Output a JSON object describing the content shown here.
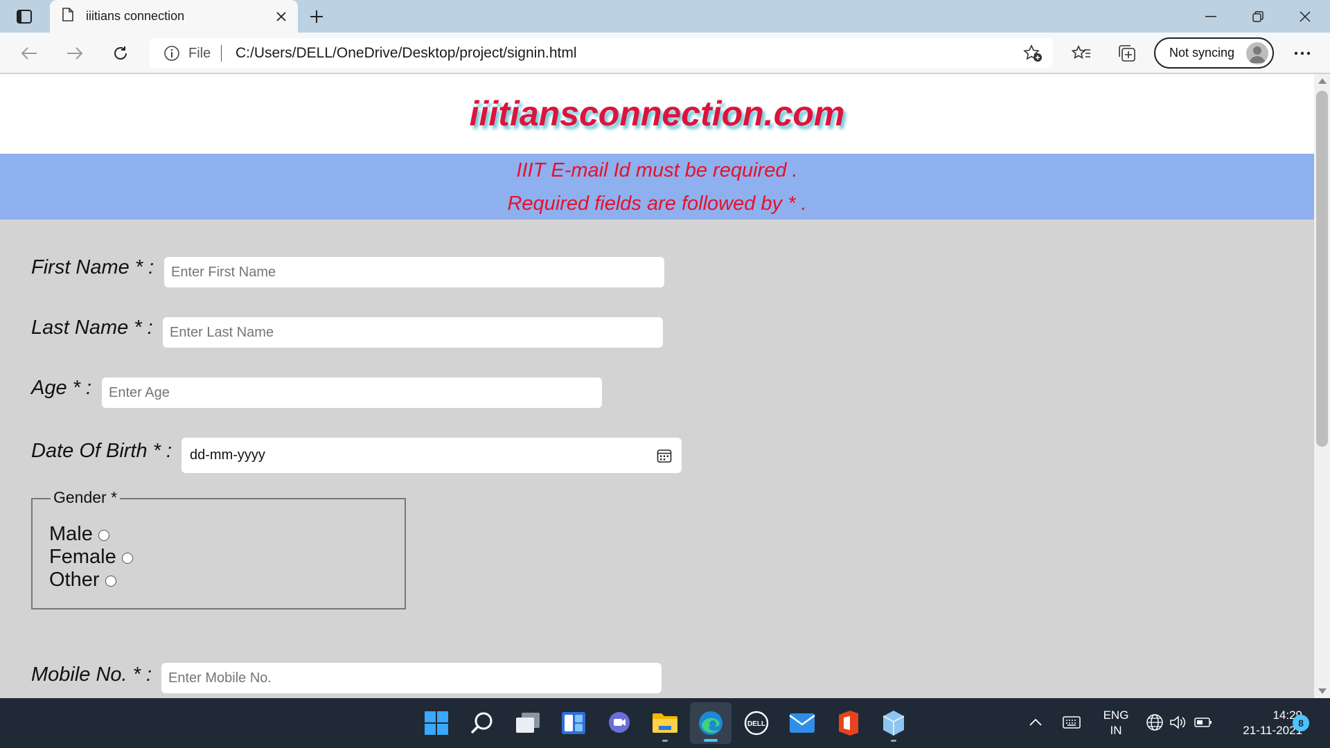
{
  "browser": {
    "tab_title": "iiitians connection",
    "address_file_label": "File",
    "address_url": "C:/Users/DELL/OneDrive/Desktop/project/signin.html",
    "sync_label": "Not syncing"
  },
  "page": {
    "site_title": "iiitiansconnection.com",
    "notice_line_1": "IIIT E-mail Id must be required .",
    "notice_line_2": "Required fields are followed by * .",
    "form": {
      "first_name_label": "First Name * :",
      "first_name_placeholder": "Enter First Name",
      "last_name_label": "Last Name * :",
      "last_name_placeholder": "Enter Last Name",
      "age_label": "Age * :",
      "age_placeholder": "Enter Age",
      "dob_label": "Date Of Birth * :",
      "dob_value": "dd-mm-yyyy",
      "gender_legend": "Gender *",
      "gender_options": [
        "Male",
        "Female",
        "Other"
      ],
      "mobile_label": "Mobile No. * :",
      "mobile_placeholder": "Enter Mobile No."
    }
  },
  "taskbar": {
    "apps": [
      "start-icon",
      "search-icon",
      "task-view-icon",
      "widgets-icon",
      "chat-icon",
      "file-explorer-icon",
      "edge-icon",
      "dell-icon",
      "mail-icon",
      "office-icon",
      "package-icon"
    ],
    "lang_line_1": "ENG",
    "lang_line_2": "IN",
    "time": "14:29",
    "date": "21-11-2021",
    "notification_count": "8"
  },
  "colors": {
    "title_red": "#dc143c",
    "notice_bg": "#8fb0ee",
    "page_bg": "#d3d3d3",
    "taskbar_bg": "#1f2a36"
  }
}
